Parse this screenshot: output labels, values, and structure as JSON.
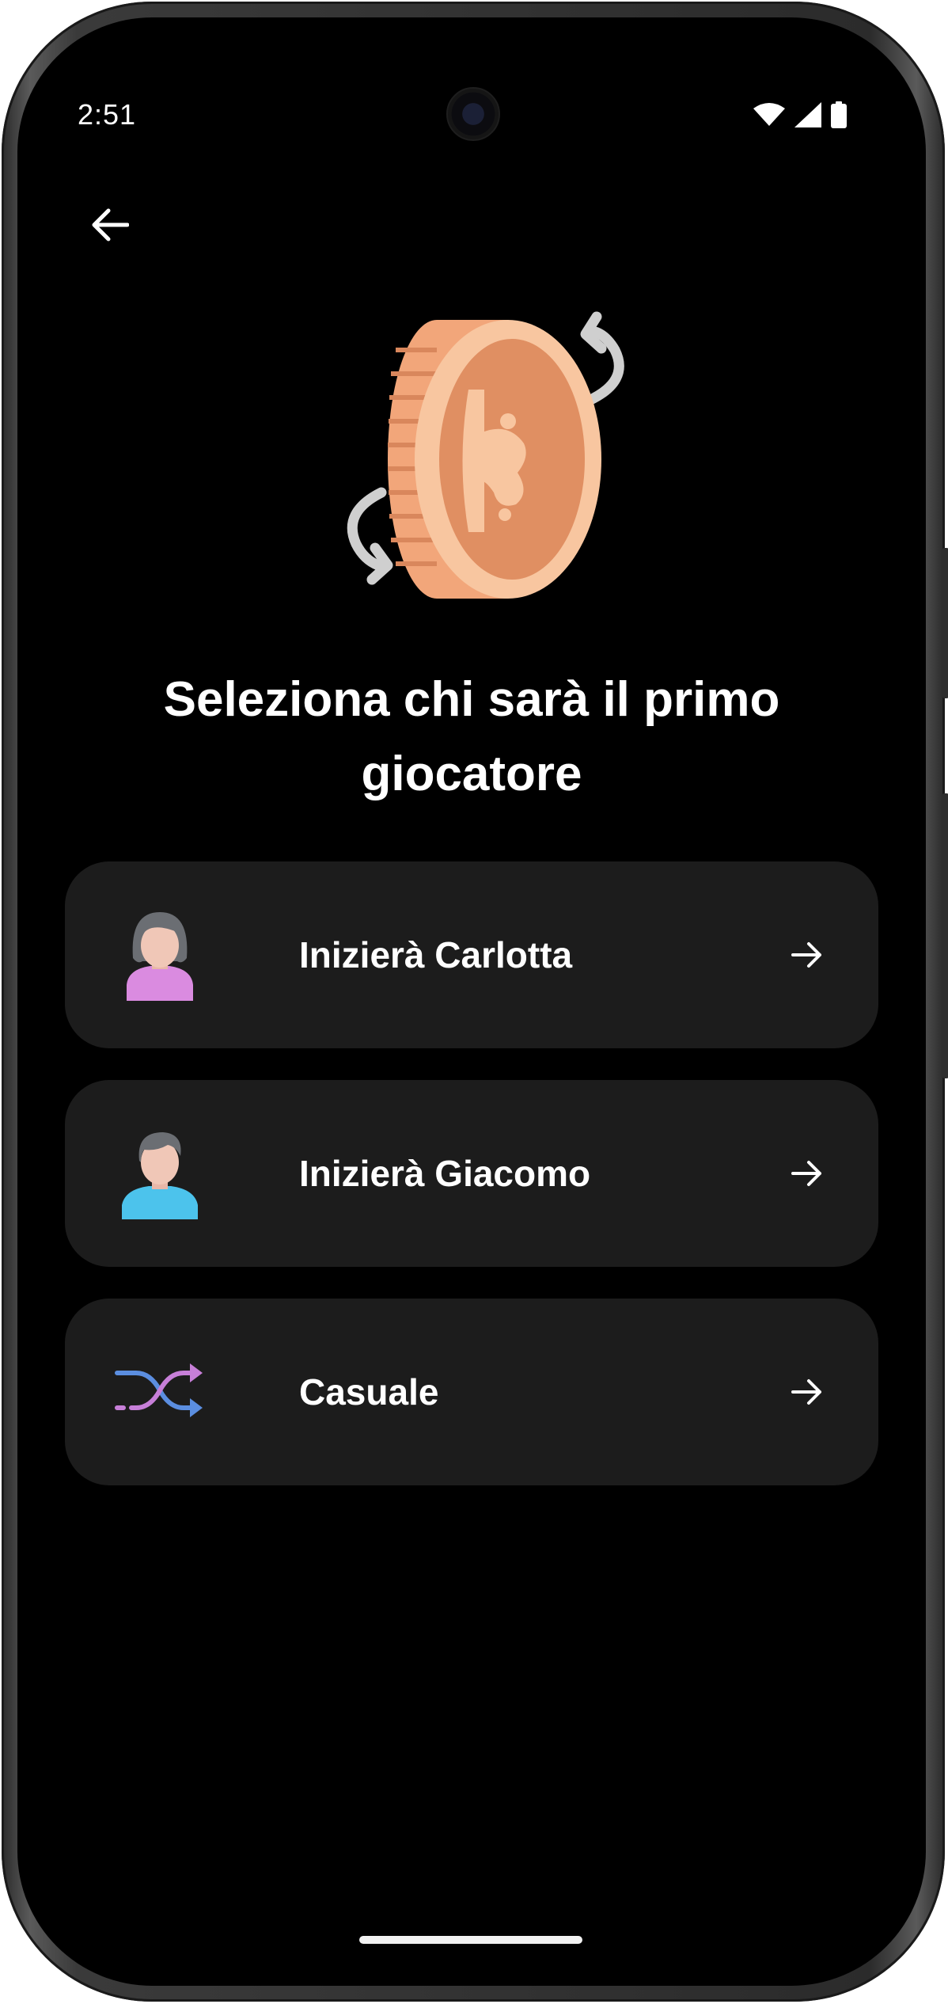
{
  "status_bar": {
    "time": "2:51",
    "icons": [
      "wifi-icon",
      "cellular-signal-icon",
      "battery-icon"
    ]
  },
  "header": {
    "back_icon": "arrow-left-icon"
  },
  "hero": {
    "icon": "coin-flip-icon"
  },
  "title": "Seleziona chi sarà il primo giocatore",
  "options": [
    {
      "label": "Inizierà Carlotta",
      "icon": "female-avatar-icon"
    },
    {
      "label": "Inizierà Giacomo",
      "icon": "male-avatar-icon"
    },
    {
      "label": "Casuale",
      "icon": "shuffle-icon"
    }
  ],
  "colors": {
    "background": "#000000",
    "card": "#1c1c1c",
    "text": "#ffffff",
    "coin_light": "#f8c6a0",
    "coin_dark": "#e08f62"
  }
}
